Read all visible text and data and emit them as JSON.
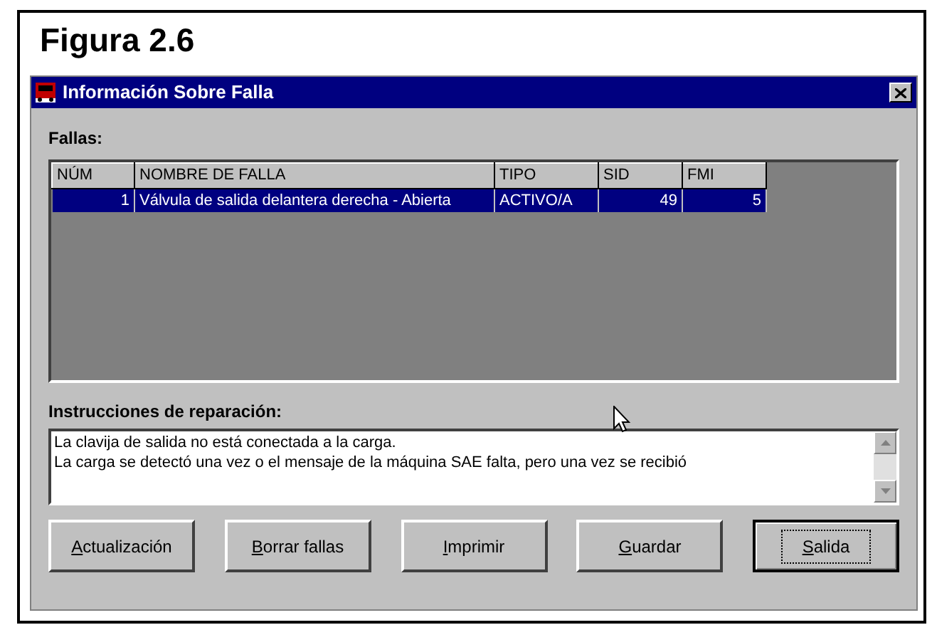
{
  "figure_caption": "Figura 2.6",
  "window": {
    "title": "Información Sobre Falla"
  },
  "faults": {
    "label": "Fallas:",
    "columns": [
      "NÚM",
      "NOMBRE DE FALLA",
      "TIPO",
      "SID",
      "FMI"
    ],
    "rows": [
      {
        "cells": [
          "1",
          "Válvula de salida delantera derecha - Abierta",
          "ACTIVO/A",
          "49",
          "5"
        ],
        "selected": true
      }
    ]
  },
  "instructions": {
    "label": "Instrucciones de reparación:",
    "lines": [
      "La clavija de salida no está conectada a la carga.",
      "La carga se detectó una vez o el mensaje de la máquina SAE falta, pero una vez se recibió"
    ]
  },
  "buttons": [
    {
      "label": "Actualización",
      "focused": false
    },
    {
      "label": "Borrar fallas",
      "focused": false
    },
    {
      "label": "Imprimir",
      "focused": false
    },
    {
      "label": "Guardar",
      "focused": false
    },
    {
      "label": "Salida",
      "focused": true
    }
  ]
}
